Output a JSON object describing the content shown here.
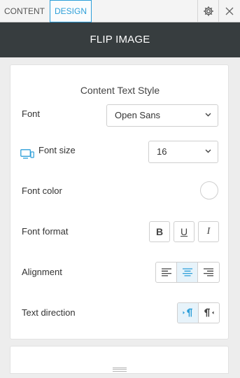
{
  "tabs": [
    {
      "label": "CONTENT",
      "active": false
    },
    {
      "label": "DESIGN",
      "active": true
    }
  ],
  "header": {
    "title": "FLIP IMAGE"
  },
  "section": {
    "title": "Content Text Style"
  },
  "font": {
    "label": "Font",
    "value": "Open Sans"
  },
  "font_size": {
    "label": "Font size",
    "value": "16"
  },
  "font_color": {
    "label": "Font color",
    "value": "#ffffff"
  },
  "font_format": {
    "label": "Font format",
    "bold": "B",
    "underline": "U",
    "italic": "I"
  },
  "alignment": {
    "label": "Alignment",
    "active": "center"
  },
  "text_direction": {
    "label": "Text direction",
    "active": "ltr"
  },
  "colors": {
    "accent": "#2d9fd9",
    "title_bar": "#373d3f"
  }
}
